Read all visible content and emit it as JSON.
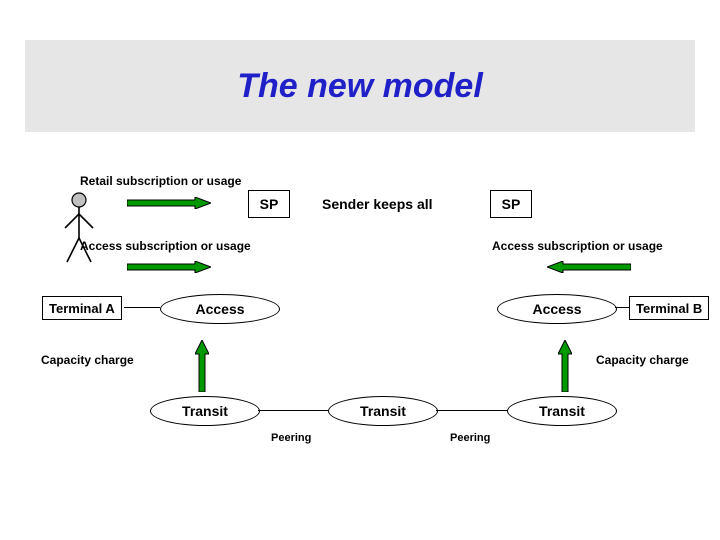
{
  "title": "The new model",
  "labels": {
    "retail": "Retail subscription or usage",
    "access_left": "Access subscription or usage",
    "access_right": "Access subscription or usage",
    "capacity_left": "Capacity charge",
    "capacity_right": "Capacity charge",
    "sender_keeps": "Sender keeps all",
    "peering1": "Peering",
    "peering2": "Peering"
  },
  "boxes": {
    "sp1": "SP",
    "sp2": "SP",
    "terminal_a": "Terminal A",
    "terminal_b": "Terminal B",
    "access1": "Access",
    "access2": "Access",
    "transit1": "Transit",
    "transit2": "Transit",
    "transit3": "Transit"
  },
  "colors": {
    "title_bg": "#e6e6e6",
    "title_text": "#2020c8",
    "arrow_green": "#009a00",
    "arrow_border": "#000000"
  }
}
